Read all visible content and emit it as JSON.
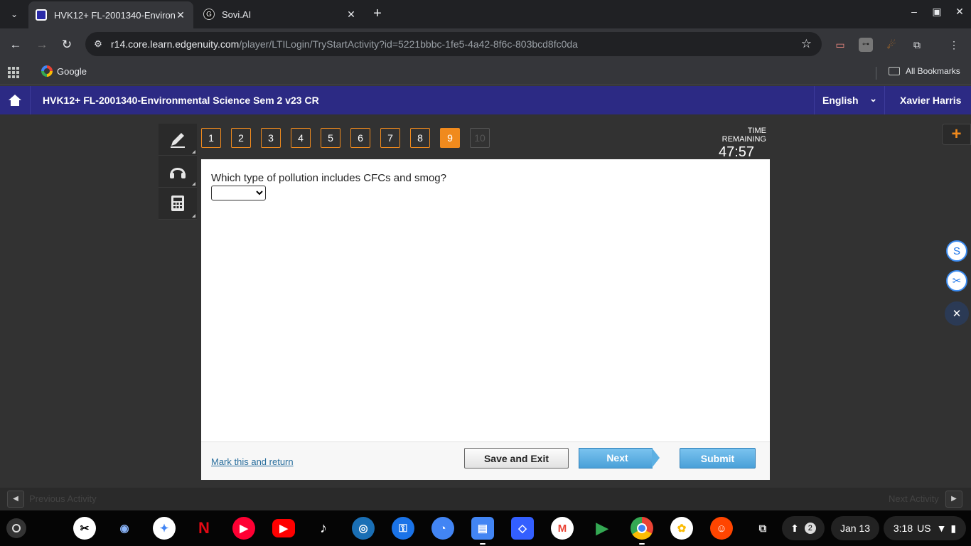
{
  "browser": {
    "tabs": [
      {
        "title": "HVK12+ FL-2001340-Environmental Science Sem 2 v23 CR",
        "active": true
      },
      {
        "title": "Sovi.AI",
        "active": false
      }
    ],
    "url_host": "r14.core.learn.edgenuity.com",
    "url_path": "/player/LTILogin/TryStartActivity?id=5221bbbc-1fe5-4a42-8f6c-803bcd8fc0da",
    "bookmarks": {
      "google": "Google",
      "all": "All Bookmarks"
    }
  },
  "header": {
    "course_title": "HVK12+ FL-2001340-Environmental Science Sem 2 v23 CR",
    "language": "English",
    "user_name": "Xavier Harris"
  },
  "activity": {
    "question_numbers": [
      "1",
      "2",
      "3",
      "4",
      "5",
      "6",
      "7",
      "8",
      "9",
      "10"
    ],
    "current_question": "9",
    "timer_label": "TIME REMAINING",
    "timer_value": "47:57",
    "question_text": "Which type of pollution includes CFCs and smog?",
    "answer_selected": "",
    "mark_link": "Mark this and return",
    "save_exit": "Save and Exit",
    "next": "Next",
    "submit": "Submit",
    "prev_activity": "Previous Activity",
    "next_activity": "Next Activity"
  },
  "taskbar": {
    "notification_count": "2",
    "date": "Jan 13",
    "time": "3:18",
    "locale": "US"
  },
  "colors": {
    "header_bg": "#2c2a84",
    "accent_orange": "#f08a1d",
    "button_blue": "#4aa0d8"
  }
}
